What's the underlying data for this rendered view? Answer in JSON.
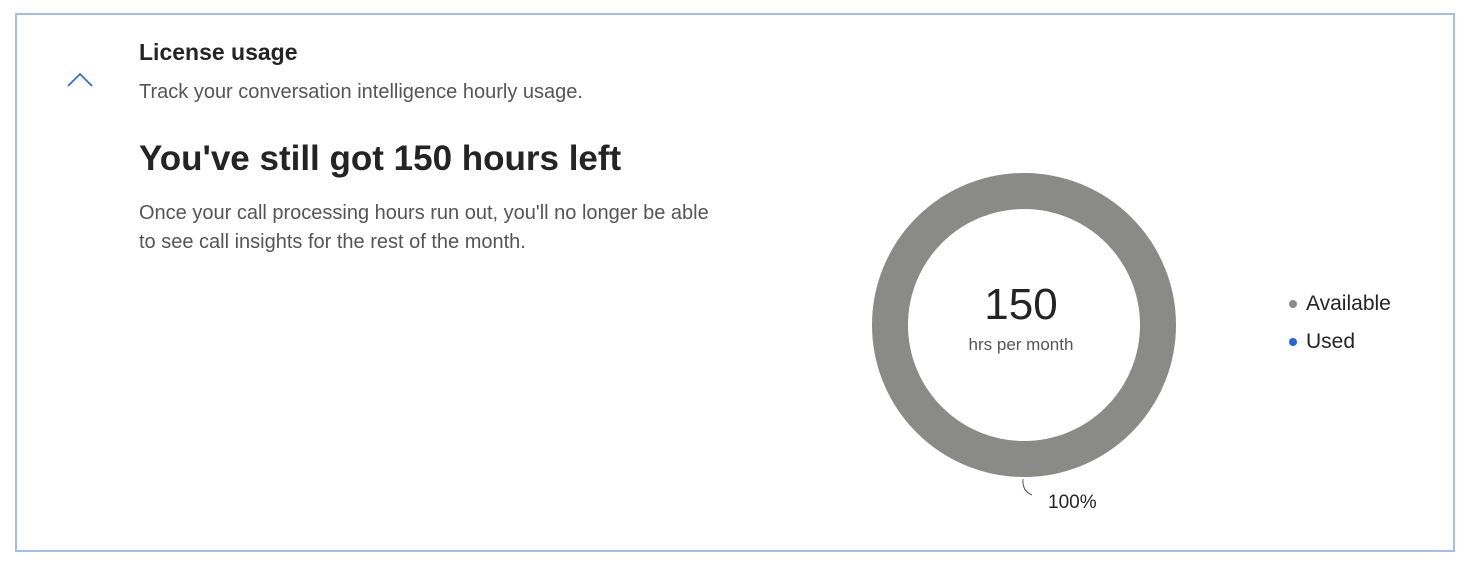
{
  "section": {
    "title": "License usage",
    "subtitle": "Track your conversation intelligence hourly usage.",
    "headline": "You've still got 150 hours left",
    "description": "Once your call processing hours run out, you'll no longer be able to see call insights for the rest of the month.",
    "collapse_icon": "chevron-up-icon"
  },
  "chart_data": {
    "type": "pie",
    "variant": "donut",
    "center_value": "150",
    "center_label": "hrs per month",
    "series": [
      {
        "name": "Available",
        "value": 150,
        "percent_label": "100%",
        "color": "#8a8a89"
      },
      {
        "name": "Used",
        "value": 0,
        "color": "#2563eb"
      }
    ],
    "legend_position": "right"
  },
  "colors": {
    "border": "#a4bdf0",
    "accent": "#2563eb",
    "available": "#8a8a89"
  }
}
